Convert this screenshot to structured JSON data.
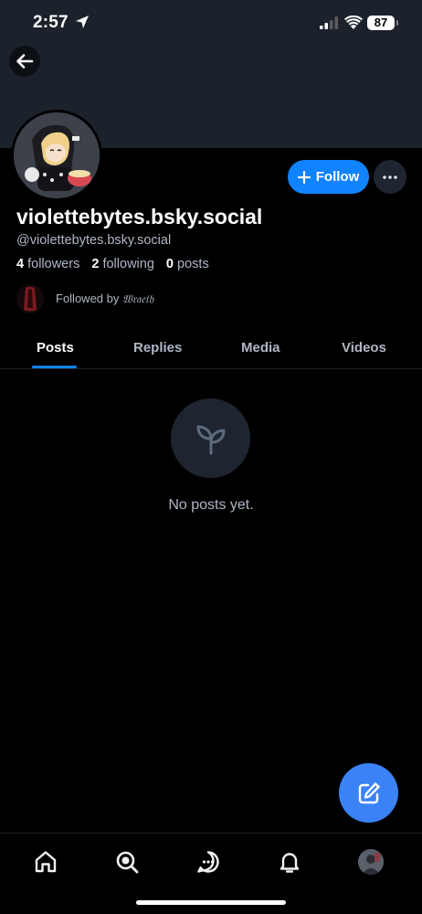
{
  "status_bar": {
    "time": "2:57",
    "battery": "87"
  },
  "header": {
    "banner_color": "#1c222b"
  },
  "profile": {
    "display_name": "violettebytes.bsky.social",
    "handle": "@violettebytes.bsky.social",
    "followers_count": "4",
    "followers_label": "followers",
    "following_count": "2",
    "following_label": "following",
    "posts_count": "0",
    "posts_label": "posts",
    "followed_by_prefix": "Followed by",
    "followed_by_name": "𝔚𝔯𝔞𝔢𝔱𝔥"
  },
  "actions": {
    "follow_label": "Follow"
  },
  "tabs": [
    {
      "label": "Posts",
      "active": true
    },
    {
      "label": "Replies",
      "active": false
    },
    {
      "label": "Media",
      "active": false
    },
    {
      "label": "Videos",
      "active": false
    }
  ],
  "empty_state": {
    "message": "No posts yet."
  },
  "bottom_nav": {
    "items": [
      {
        "icon": "home-icon"
      },
      {
        "icon": "search-icon"
      },
      {
        "icon": "chat-icon"
      },
      {
        "icon": "bell-icon"
      },
      {
        "icon": "profile-avatar"
      }
    ]
  },
  "colors": {
    "accent": "#1083fe",
    "fab": "#3b82f6",
    "background": "#000000",
    "muted_text": "#aeb7c3"
  }
}
